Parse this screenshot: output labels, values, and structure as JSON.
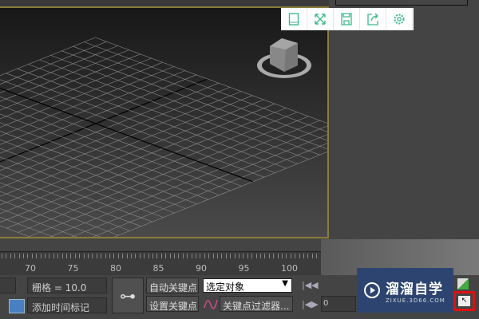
{
  "toolbar": {
    "icons": [
      "tablet-icon",
      "fullscreen-icon",
      "save-icon",
      "share-icon",
      "settings-icon"
    ],
    "accent": "#3dbb8a"
  },
  "timeline": {
    "labels": [
      "70",
      "75",
      "80",
      "85",
      "90",
      "95",
      "100"
    ]
  },
  "bottom": {
    "grid_label": "栅格 = 10.0",
    "add_time_tag": "添加时间标记",
    "auto_key": "自动关键点",
    "set_key": "设置关键点",
    "selection_dropdown": "选定对象",
    "key_filters": "关键点过滤器...",
    "frame_field": "0"
  },
  "watermark": {
    "brand": "溜溜自学",
    "url": "ZIXUE.3D66.COM"
  },
  "colors": {
    "viewport_border": "#8a7c3c",
    "highlight": "#e01010"
  }
}
